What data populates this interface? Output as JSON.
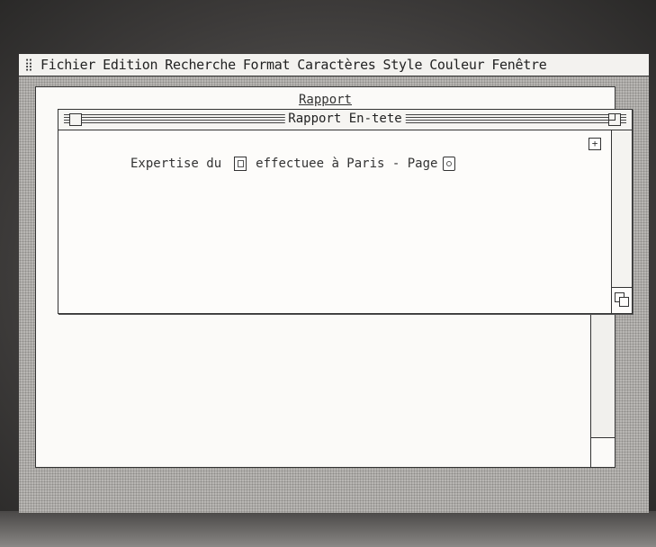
{
  "menubar": {
    "apple_icon": "apple-menu-icon",
    "items": [
      "Fichier",
      "Edition",
      "Recherche",
      "Format",
      "Caractères",
      "Style",
      "Couleur",
      "Fenêtre"
    ]
  },
  "back_window": {
    "title": "Rapport"
  },
  "front_window": {
    "title": "Rapport En-tete",
    "content": {
      "text_before_date": "Expertise du",
      "text_after_date": "effectuee à Paris - Page"
    }
  },
  "colors": {
    "desktop": "#b8b6b3",
    "window": "#fbfaf8",
    "text": "#222222"
  }
}
